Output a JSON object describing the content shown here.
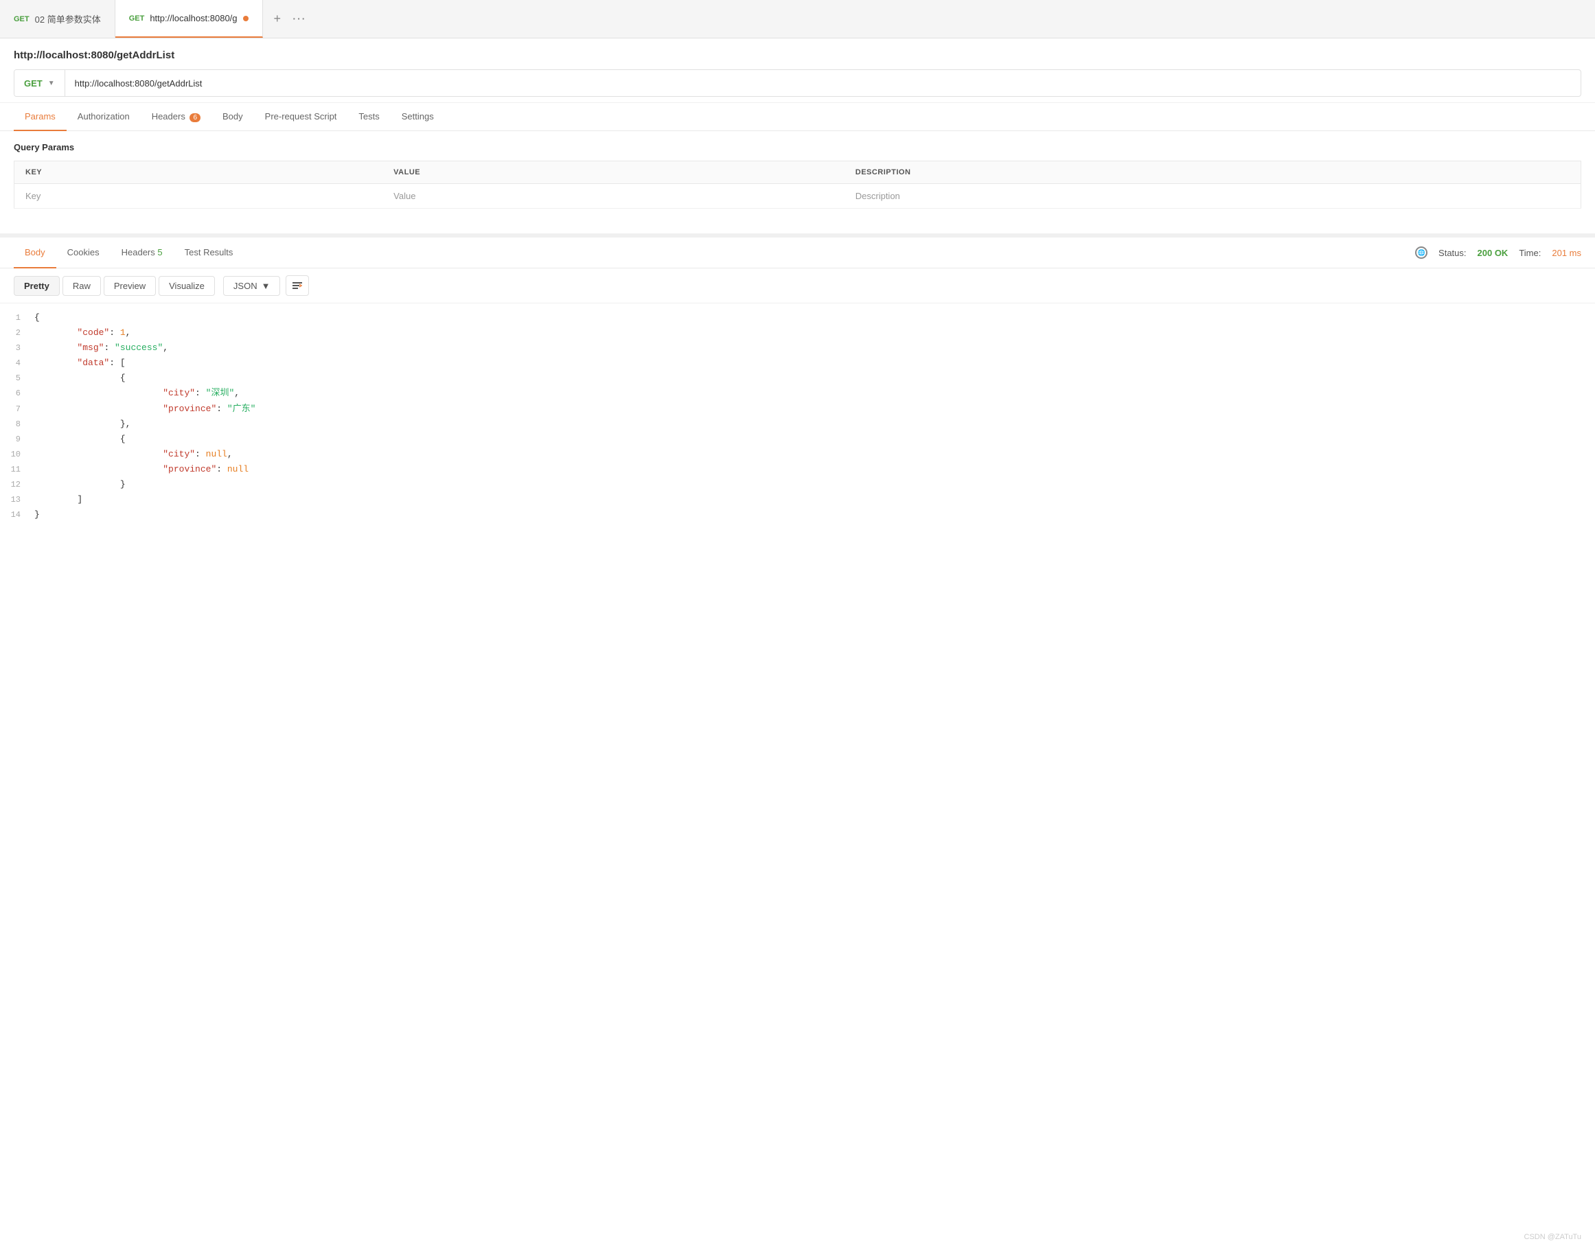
{
  "tabs": [
    {
      "id": "tab1",
      "method": "GET",
      "label": "02 简单参数实体",
      "active": false,
      "has_dot": false
    },
    {
      "id": "tab2",
      "method": "GET",
      "label": "http://localhost:8080/g",
      "active": true,
      "has_dot": true
    }
  ],
  "tab_add_label": "+",
  "tab_more_label": "···",
  "url_title": "http://localhost:8080/getAddrList",
  "method": "GET",
  "url_value": "http://localhost:8080/getAddrList",
  "request_tabs": [
    {
      "label": "Params",
      "active": true,
      "badge": ""
    },
    {
      "label": "Authorization",
      "active": false,
      "badge": ""
    },
    {
      "label": "Headers",
      "active": false,
      "badge": "6"
    },
    {
      "label": "Body",
      "active": false,
      "badge": ""
    },
    {
      "label": "Pre-request Script",
      "active": false,
      "badge": ""
    },
    {
      "label": "Tests",
      "active": false,
      "badge": ""
    },
    {
      "label": "Settings",
      "active": false,
      "badge": ""
    }
  ],
  "query_params_title": "Query Params",
  "params_columns": [
    "KEY",
    "VALUE",
    "DESCRIPTION"
  ],
  "params_placeholder": {
    "key": "Key",
    "value": "Value",
    "description": "Description"
  },
  "response_tabs": [
    {
      "label": "Body",
      "active": true,
      "badge_type": ""
    },
    {
      "label": "Cookies",
      "active": false,
      "badge_type": ""
    },
    {
      "label": "Headers",
      "active": false,
      "badge_type": "green",
      "badge_num": "5"
    },
    {
      "label": "Test Results",
      "active": false,
      "badge_type": ""
    }
  ],
  "status": {
    "status_label": "Status:",
    "status_value": "200 OK",
    "time_label": "Time:",
    "time_value": "201 ms"
  },
  "format_buttons": [
    "Pretty",
    "Raw",
    "Preview",
    "Visualize"
  ],
  "format_active": "Pretty",
  "json_format": "JSON",
  "json_lines": [
    {
      "num": 1,
      "content_raw": "{",
      "type": "brace_open"
    },
    {
      "num": 2,
      "content_raw": "    \"code\": 1,",
      "key": "code",
      "value": "1",
      "type": "kv_number"
    },
    {
      "num": 3,
      "content_raw": "    \"msg\": \"success\",",
      "key": "msg",
      "value": "success",
      "type": "kv_string"
    },
    {
      "num": 4,
      "content_raw": "    \"data\": [",
      "key": "data",
      "type": "kv_array_open"
    },
    {
      "num": 5,
      "content_raw": "        {",
      "type": "brace_open_indent2"
    },
    {
      "num": 6,
      "content_raw": "            \"city\": \"深圳\",",
      "key": "city",
      "value": "深圳",
      "type": "kv_string_indent3"
    },
    {
      "num": 7,
      "content_raw": "            \"province\": \"广东\"",
      "key": "province",
      "value": "广东",
      "type": "kv_string_indent3_last"
    },
    {
      "num": 8,
      "content_raw": "        },",
      "type": "brace_close_indent2_comma"
    },
    {
      "num": 9,
      "content_raw": "        {",
      "type": "brace_open_indent2"
    },
    {
      "num": 10,
      "content_raw": "            \"city\": null,",
      "key": "city",
      "value": "null",
      "type": "kv_null_indent3"
    },
    {
      "num": 11,
      "content_raw": "            \"province\": null",
      "key": "province",
      "value": "null",
      "type": "kv_null_indent3_last"
    },
    {
      "num": 12,
      "content_raw": "        }",
      "type": "brace_close_indent2"
    },
    {
      "num": 13,
      "content_raw": "    ]",
      "type": "array_close"
    },
    {
      "num": 14,
      "content_raw": "}",
      "type": "brace_close"
    }
  ],
  "watermark": "CSDN @ZATuTu"
}
